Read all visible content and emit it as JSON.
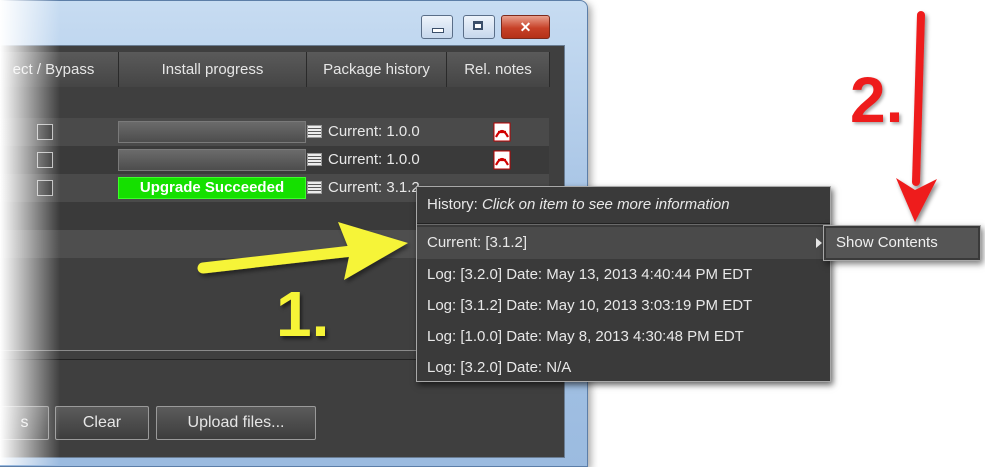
{
  "window": {
    "controls": {
      "minimize": "minimize-icon",
      "maximize": "maximize-icon",
      "close": "close-icon"
    }
  },
  "table": {
    "columns": [
      "ect / Bypass",
      "Install progress",
      "Package history",
      "Rel. notes"
    ],
    "rows": [
      {
        "progress": "",
        "package": "Current: 1.0.0"
      },
      {
        "progress": "",
        "package": "Current: 1.0.0"
      },
      {
        "progress": "Upgrade Succeeded",
        "package": "Current: 3.1.2"
      }
    ]
  },
  "menu": {
    "title_prefix": "History:",
    "title_hint": "Click on item to see more information",
    "items": [
      "Current: [3.1.2]",
      "Log: [3.2.0] Date: May 13, 2013 4:40:44 PM EDT",
      "Log: [3.1.2] Date: May 10, 2013 3:03:19 PM EDT",
      "Log: [1.0.0] Date: May 8, 2013 4:30:48 PM EDT",
      "Log: [3.2.0] Date: N/A"
    ],
    "submenu_item": "Show Contents"
  },
  "buttons": {
    "partial": "s",
    "clear": "Clear",
    "upload": "Upload files..."
  },
  "annotations": {
    "step1": "1.",
    "step2": "2."
  },
  "colors": {
    "success": "#15e000",
    "step1": "#f6f437",
    "step2": "#ee1c1c"
  }
}
